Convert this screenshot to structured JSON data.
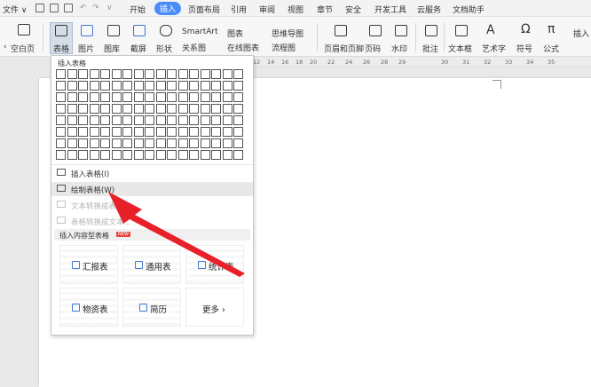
{
  "menubar": {
    "file": "文件 ∨",
    "tabs": [
      "开始",
      "插入",
      "页面布局",
      "引用",
      "审阅",
      "视图",
      "章节",
      "安全",
      "开发工具",
      "云服务",
      "文档助手"
    ],
    "active_tab": "插入"
  },
  "ribbon": {
    "blank_page": "空白页",
    "table": "表格",
    "picture": "图片",
    "gallery": "图库",
    "screenshot": "截屏",
    "shape": "形状",
    "smartart": "SmartArt",
    "chart": "图表",
    "mindmap": "思维导图",
    "relation": "关系图",
    "online_chart": "在线图表",
    "flowchart": "流程图",
    "header_footer": "页眉和页脚",
    "page_number": "页码",
    "watermark": "水印",
    "comment": "批注",
    "textbox": "文本框",
    "art_text": "艺术字",
    "symbol": "符号",
    "formula": "公式",
    "insert_more": "插入"
  },
  "ruler": [
    "12",
    "14",
    "16",
    "18",
    "20",
    "22",
    "24",
    "26",
    "28",
    "29",
    "30",
    "31",
    "32",
    "33",
    "34",
    "35"
  ],
  "dropdown": {
    "title": "插入表格",
    "items": [
      {
        "label": "插入表格(I)",
        "disabled": false
      },
      {
        "label": "绘制表格(W)",
        "disabled": false,
        "hover": true
      },
      {
        "label": "文本转换成表格...",
        "disabled": true
      },
      {
        "label": "表格转换成文本...",
        "disabled": true
      }
    ],
    "section_title": "插入内容型表格",
    "section_badge": "NEW",
    "cards": [
      {
        "label": "汇报表",
        "icon": "edit-icon"
      },
      {
        "label": "通用表",
        "icon": "grid-icon"
      },
      {
        "label": "统计表",
        "icon": "chart-icon"
      },
      {
        "label": "物资表",
        "icon": "box-icon"
      },
      {
        "label": "简历",
        "icon": "resume-icon"
      },
      {
        "label": "更多 ›",
        "icon": ""
      }
    ]
  },
  "colors": {
    "accent": "#4a8df8",
    "arrow": "#e8202a",
    "icon_blue": "#3d77d6"
  }
}
